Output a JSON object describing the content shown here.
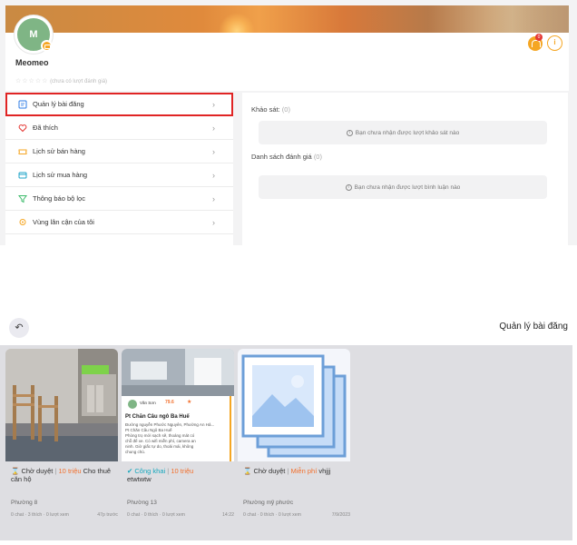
{
  "profile": {
    "avatar_initial": "M",
    "username": "Meomeo",
    "rating_stars": "☆☆☆☆☆",
    "rating_text": "(chưa có lượt đánh giá)",
    "notification_count": "0",
    "info_label": "i"
  },
  "menu": {
    "items": [
      {
        "label": "Quản lý bài đăng",
        "icon": "post-icon",
        "color": "#2d7be5"
      },
      {
        "label": "Đã thích",
        "icon": "heart-icon",
        "color": "#e53935"
      },
      {
        "label": "Lịch sử bán hàng",
        "icon": "ticket-icon",
        "color": "#f5a623"
      },
      {
        "label": "Lịch sử mua hàng",
        "icon": "card-icon",
        "color": "#20a4c8"
      },
      {
        "label": "Thông báo bộ lọc",
        "icon": "filter-icon",
        "color": "#3dbb6b"
      },
      {
        "label": "Vùng lân cận của tôi",
        "icon": "location-icon",
        "color": "#f5a623"
      }
    ],
    "chevron": "›"
  },
  "right": {
    "survey_title": "Khảo sát:",
    "survey_count": "(0)",
    "survey_empty": "Bạn chưa nhận được lượt khảo sát nào",
    "reviews_title": "Danh sách đánh giá",
    "reviews_count": "(0)",
    "reviews_empty": "Bạn chưa nhận được lượt bình luận nào"
  },
  "manage": {
    "back_symbol": "↶",
    "title": "Quản lý bài đăng",
    "posts": [
      {
        "status_icon": "⌛",
        "status": "Chờ duyệt",
        "price": "10 triệu",
        "title": "Cho thuê căn hộ",
        "ward": "Phường 8",
        "meta": "0 chat · 3 thích · 0 lượt xem",
        "time": "47p trước"
      },
      {
        "status_icon": "✔",
        "status": "Công khai",
        "price": "10 triệu",
        "title": "etwtwtw",
        "ward": "Phường 13",
        "meta": "0 chat · 0 thích · 0 lượt xem",
        "time": "14:22",
        "flyer": {
          "author": "Văn Sơn",
          "price": "79.6",
          "rating": "★",
          "name": "Pt Chăn Câu ngô Ba Huế",
          "lines": [
            "Đường nguyễn Phước Nguyên, Phường An Hả...",
            "Pt Chăn Câu Ngô Ba Huế",
            "Phòng trọ mới sạch sẽ, thoáng mát có",
            "chỗ để xe. Có wifi miễn phí, camera an",
            "ninh. Giờ giấc tự do, thoải mái, không",
            "chung chủ."
          ]
        }
      },
      {
        "status_icon": "⌛",
        "status": "Chờ duyệt",
        "price": "Miễn phí",
        "title": "vhjjj",
        "ward": "Phường mỹ phước",
        "meta": "0 chat · 0 thích · 0 lượt xem",
        "time": "7/9/2023"
      }
    ]
  },
  "colors": {
    "accent_orange": "#f2702d",
    "approved_teal": "#16a7bd",
    "active_outline": "#e02424"
  }
}
